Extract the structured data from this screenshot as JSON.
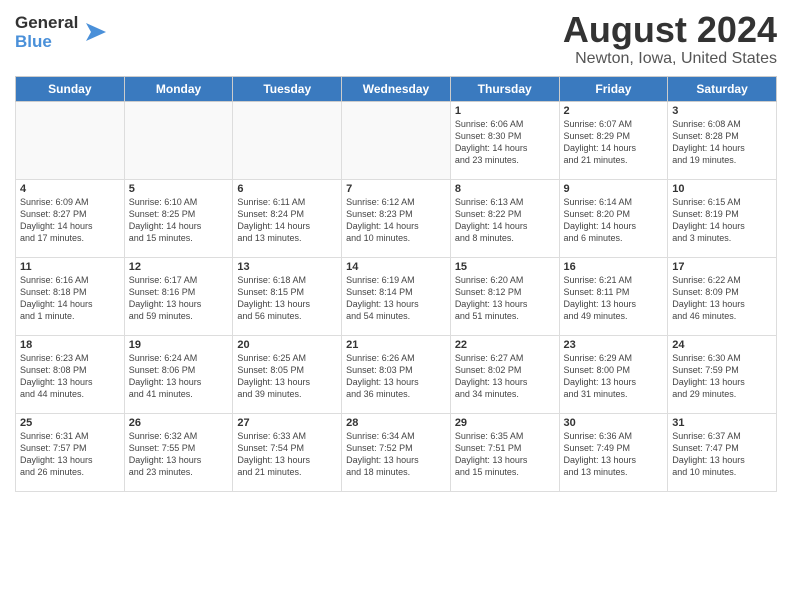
{
  "header": {
    "logo_line1": "General",
    "logo_line2": "Blue",
    "title": "August 2024",
    "subtitle": "Newton, Iowa, United States"
  },
  "weekdays": [
    "Sunday",
    "Monday",
    "Tuesday",
    "Wednesday",
    "Thursday",
    "Friday",
    "Saturday"
  ],
  "weeks": [
    [
      {
        "day": "",
        "info": "",
        "empty": true
      },
      {
        "day": "",
        "info": "",
        "empty": true
      },
      {
        "day": "",
        "info": "",
        "empty": true
      },
      {
        "day": "",
        "info": "",
        "empty": true
      },
      {
        "day": "1",
        "info": "Sunrise: 6:06 AM\nSunset: 8:30 PM\nDaylight: 14 hours\nand 23 minutes."
      },
      {
        "day": "2",
        "info": "Sunrise: 6:07 AM\nSunset: 8:29 PM\nDaylight: 14 hours\nand 21 minutes."
      },
      {
        "day": "3",
        "info": "Sunrise: 6:08 AM\nSunset: 8:28 PM\nDaylight: 14 hours\nand 19 minutes."
      }
    ],
    [
      {
        "day": "4",
        "info": "Sunrise: 6:09 AM\nSunset: 8:27 PM\nDaylight: 14 hours\nand 17 minutes."
      },
      {
        "day": "5",
        "info": "Sunrise: 6:10 AM\nSunset: 8:25 PM\nDaylight: 14 hours\nand 15 minutes."
      },
      {
        "day": "6",
        "info": "Sunrise: 6:11 AM\nSunset: 8:24 PM\nDaylight: 14 hours\nand 13 minutes."
      },
      {
        "day": "7",
        "info": "Sunrise: 6:12 AM\nSunset: 8:23 PM\nDaylight: 14 hours\nand 10 minutes."
      },
      {
        "day": "8",
        "info": "Sunrise: 6:13 AM\nSunset: 8:22 PM\nDaylight: 14 hours\nand 8 minutes."
      },
      {
        "day": "9",
        "info": "Sunrise: 6:14 AM\nSunset: 8:20 PM\nDaylight: 14 hours\nand 6 minutes."
      },
      {
        "day": "10",
        "info": "Sunrise: 6:15 AM\nSunset: 8:19 PM\nDaylight: 14 hours\nand 3 minutes."
      }
    ],
    [
      {
        "day": "11",
        "info": "Sunrise: 6:16 AM\nSunset: 8:18 PM\nDaylight: 14 hours\nand 1 minute."
      },
      {
        "day": "12",
        "info": "Sunrise: 6:17 AM\nSunset: 8:16 PM\nDaylight: 13 hours\nand 59 minutes."
      },
      {
        "day": "13",
        "info": "Sunrise: 6:18 AM\nSunset: 8:15 PM\nDaylight: 13 hours\nand 56 minutes."
      },
      {
        "day": "14",
        "info": "Sunrise: 6:19 AM\nSunset: 8:14 PM\nDaylight: 13 hours\nand 54 minutes."
      },
      {
        "day": "15",
        "info": "Sunrise: 6:20 AM\nSunset: 8:12 PM\nDaylight: 13 hours\nand 51 minutes."
      },
      {
        "day": "16",
        "info": "Sunrise: 6:21 AM\nSunset: 8:11 PM\nDaylight: 13 hours\nand 49 minutes."
      },
      {
        "day": "17",
        "info": "Sunrise: 6:22 AM\nSunset: 8:09 PM\nDaylight: 13 hours\nand 46 minutes."
      }
    ],
    [
      {
        "day": "18",
        "info": "Sunrise: 6:23 AM\nSunset: 8:08 PM\nDaylight: 13 hours\nand 44 minutes."
      },
      {
        "day": "19",
        "info": "Sunrise: 6:24 AM\nSunset: 8:06 PM\nDaylight: 13 hours\nand 41 minutes."
      },
      {
        "day": "20",
        "info": "Sunrise: 6:25 AM\nSunset: 8:05 PM\nDaylight: 13 hours\nand 39 minutes."
      },
      {
        "day": "21",
        "info": "Sunrise: 6:26 AM\nSunset: 8:03 PM\nDaylight: 13 hours\nand 36 minutes."
      },
      {
        "day": "22",
        "info": "Sunrise: 6:27 AM\nSunset: 8:02 PM\nDaylight: 13 hours\nand 34 minutes."
      },
      {
        "day": "23",
        "info": "Sunrise: 6:29 AM\nSunset: 8:00 PM\nDaylight: 13 hours\nand 31 minutes."
      },
      {
        "day": "24",
        "info": "Sunrise: 6:30 AM\nSunset: 7:59 PM\nDaylight: 13 hours\nand 29 minutes."
      }
    ],
    [
      {
        "day": "25",
        "info": "Sunrise: 6:31 AM\nSunset: 7:57 PM\nDaylight: 13 hours\nand 26 minutes."
      },
      {
        "day": "26",
        "info": "Sunrise: 6:32 AM\nSunset: 7:55 PM\nDaylight: 13 hours\nand 23 minutes."
      },
      {
        "day": "27",
        "info": "Sunrise: 6:33 AM\nSunset: 7:54 PM\nDaylight: 13 hours\nand 21 minutes."
      },
      {
        "day": "28",
        "info": "Sunrise: 6:34 AM\nSunset: 7:52 PM\nDaylight: 13 hours\nand 18 minutes."
      },
      {
        "day": "29",
        "info": "Sunrise: 6:35 AM\nSunset: 7:51 PM\nDaylight: 13 hours\nand 15 minutes."
      },
      {
        "day": "30",
        "info": "Sunrise: 6:36 AM\nSunset: 7:49 PM\nDaylight: 13 hours\nand 13 minutes."
      },
      {
        "day": "31",
        "info": "Sunrise: 6:37 AM\nSunset: 7:47 PM\nDaylight: 13 hours\nand 10 minutes."
      }
    ]
  ]
}
